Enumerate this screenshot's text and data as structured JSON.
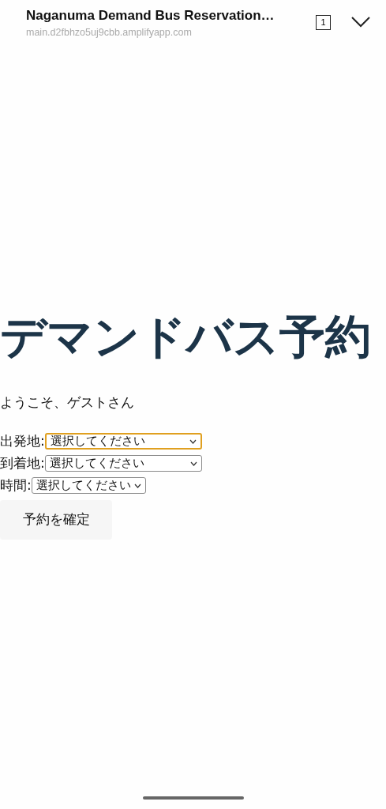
{
  "browser_bar": {
    "title": "Naganuma Demand Bus Reservation…",
    "url": "main.d2fbhzo5uj9cbb.amplifyapp.com",
    "tab_count": "1"
  },
  "heading": "デマンドバス予約",
  "welcome": "ようこそ、ゲストさん",
  "fields": [
    {
      "label": "出発地:",
      "value": "選択してください",
      "focused": true
    },
    {
      "label": "到着地:",
      "value": "選択してください",
      "focused": false
    },
    {
      "label": "時間:",
      "value": "選択してください",
      "focused": false
    }
  ],
  "submit_button": "予約を確定"
}
